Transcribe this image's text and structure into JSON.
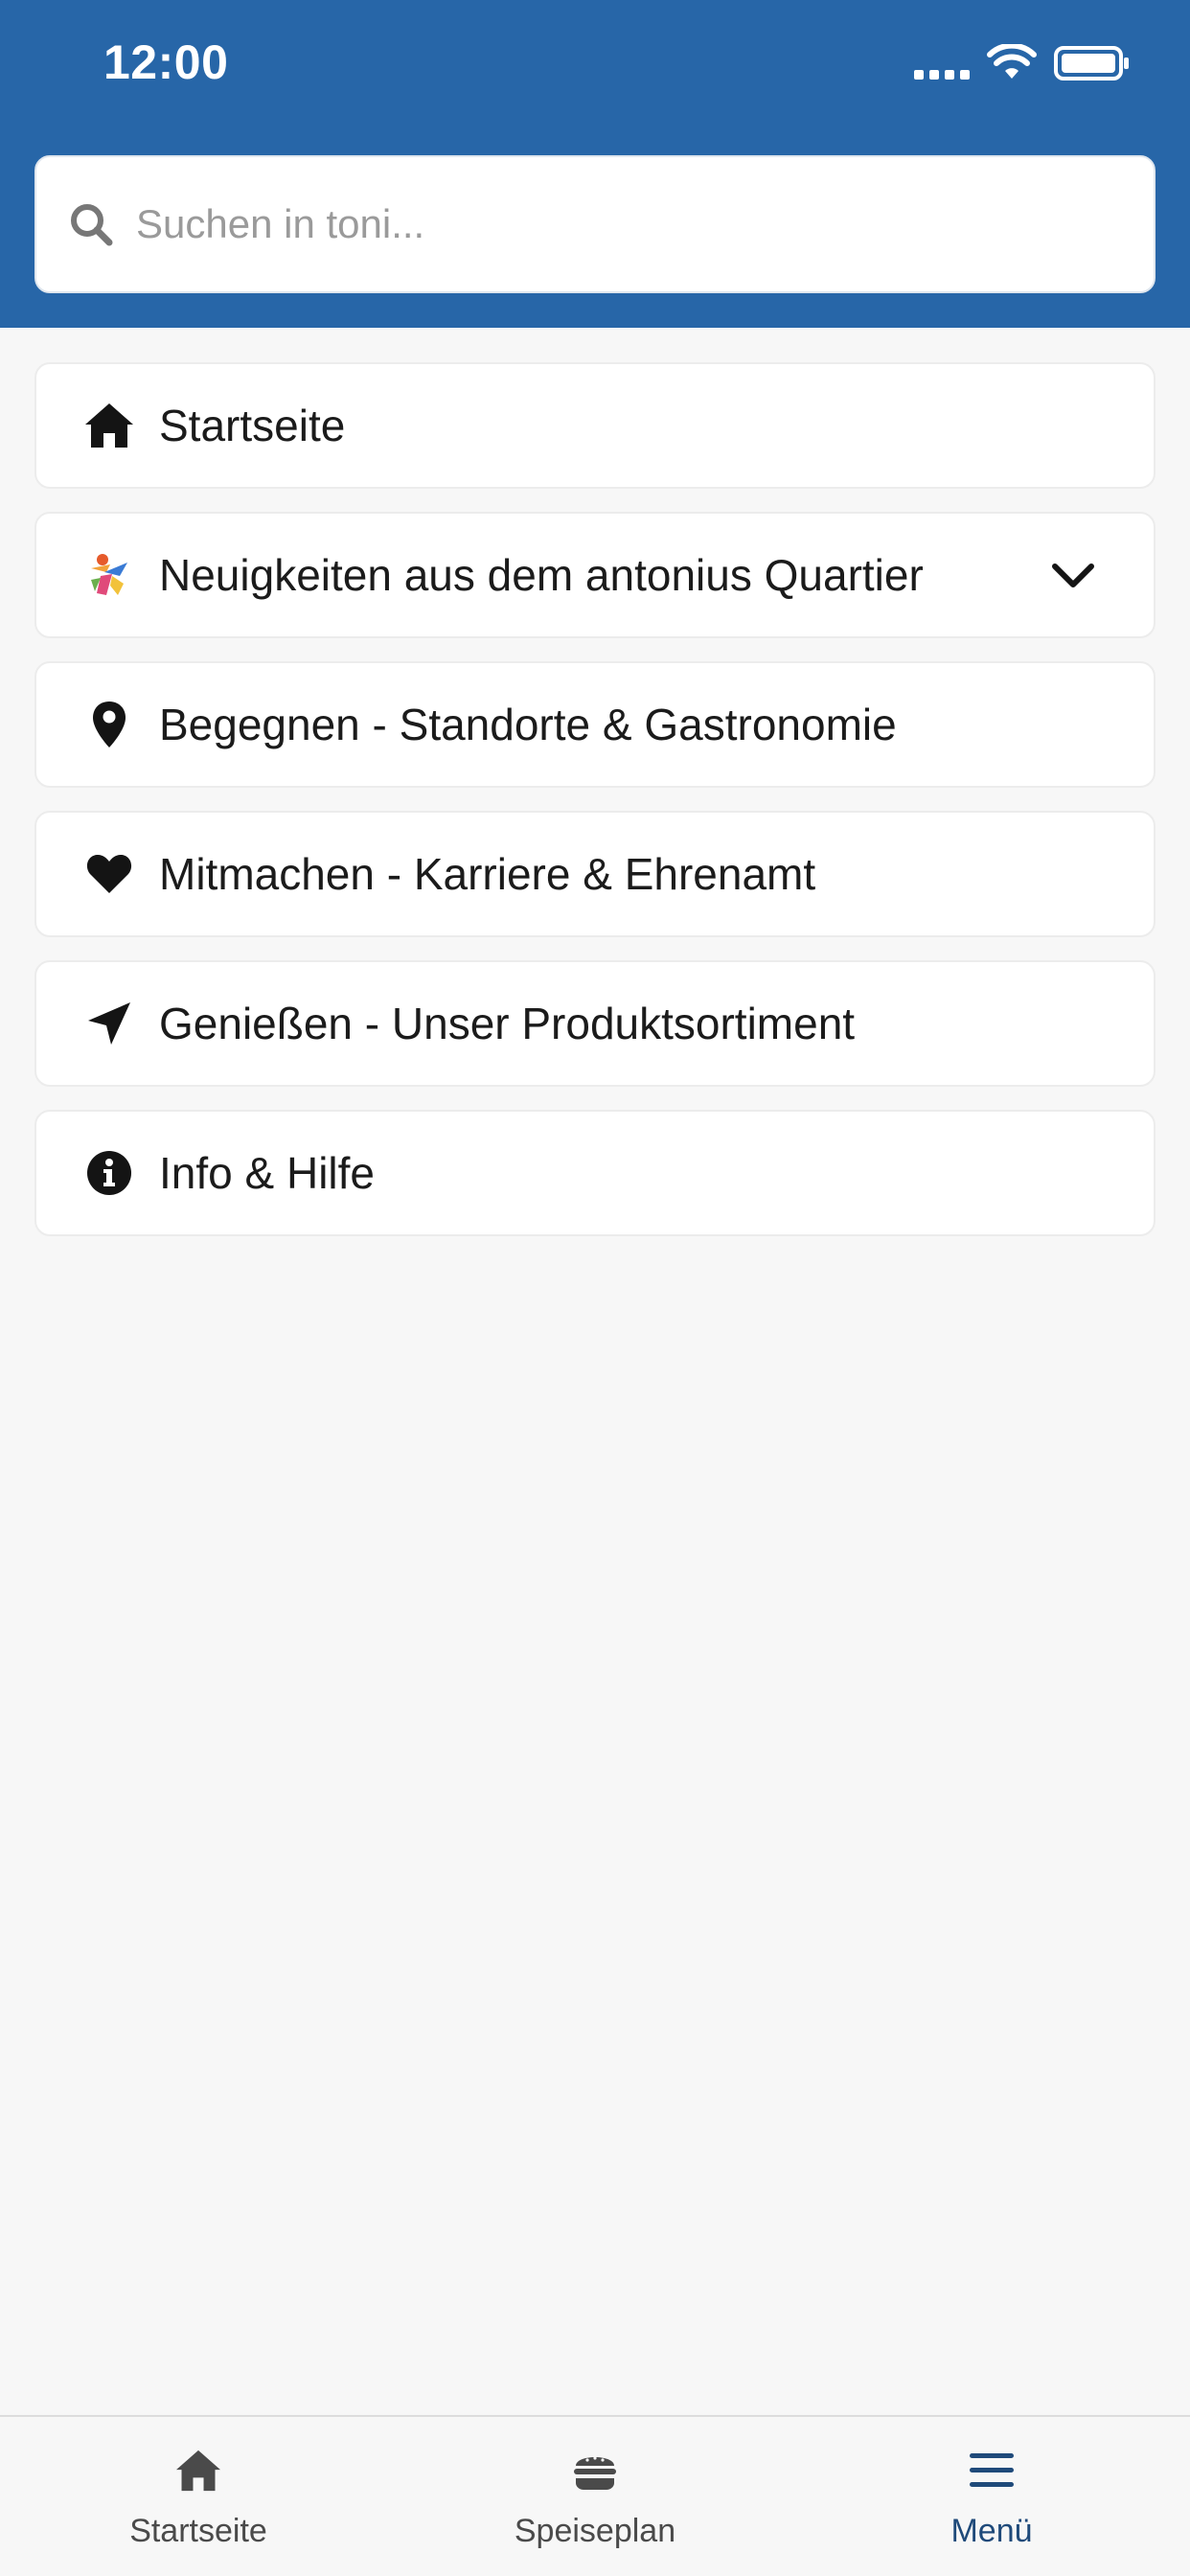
{
  "status_bar": {
    "time": "12:00"
  },
  "search": {
    "placeholder": "Suchen in toni..."
  },
  "menu": {
    "items": [
      {
        "label": "Startseite",
        "icon": "home-icon"
      },
      {
        "label": "Neuigkeiten aus dem antonius Quartier",
        "icon": "antonius-logo-icon",
        "expandable": true
      },
      {
        "label": "Begegnen - Standorte & Gastronomie",
        "icon": "location-pin-icon"
      },
      {
        "label": "Mitmachen - Karriere & Ehrenamt",
        "icon": "heart-icon"
      },
      {
        "label": "Genießen - Unser Produktsortiment",
        "icon": "paper-plane-icon"
      },
      {
        "label": "Info & Hilfe",
        "icon": "info-icon"
      }
    ]
  },
  "tabs": [
    {
      "label": "Startseite",
      "icon": "home-icon"
    },
    {
      "label": "Speiseplan",
      "icon": "burger-icon"
    },
    {
      "label": "Menü",
      "icon": "menu-icon",
      "active": true
    }
  ],
  "colors": {
    "header": "#2766a8",
    "background": "#f7f7f7",
    "active_tab": "#1f4a7a"
  }
}
